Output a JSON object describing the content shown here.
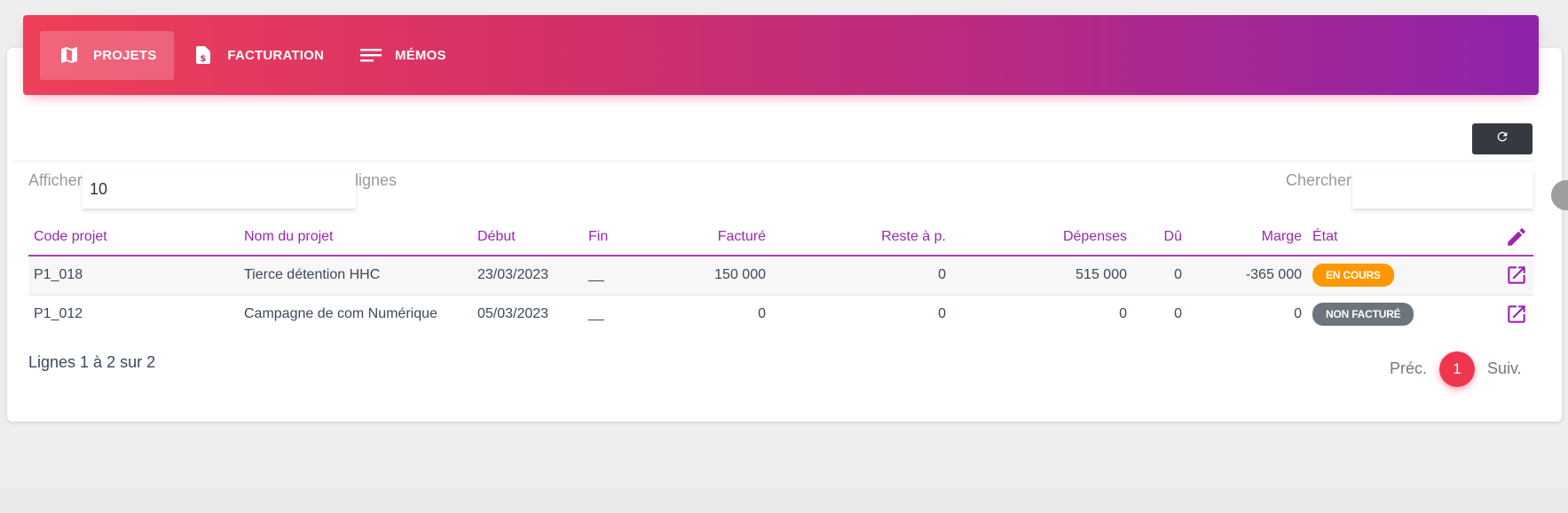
{
  "nav": {
    "tabs": [
      {
        "label": "PROJETS",
        "icon": "map-icon",
        "active": true
      },
      {
        "label": "FACTURATION",
        "icon": "invoice-icon",
        "active": false
      },
      {
        "label": "MÉMOS",
        "icon": "notes-icon",
        "active": false
      }
    ]
  },
  "toolbar": {
    "refresh_icon": "refresh-icon"
  },
  "length": {
    "prefix": "Afficher",
    "value": "10",
    "suffix": "lignes"
  },
  "search": {
    "label": "Chercher:",
    "value": ""
  },
  "table": {
    "headers": [
      "Code projet",
      "Nom du projet",
      "Début",
      "Fin",
      "Facturé",
      "Reste à p.",
      "Dépenses",
      "Dû",
      "Marge",
      "État"
    ],
    "rows": [
      {
        "code": "P1_018",
        "name": "Tierce détention HHC",
        "start": "23/03/2023",
        "end": "__",
        "billed": "150 000",
        "remaining": "0",
        "expenses": "515 000",
        "due": "0",
        "margin": "-365 000",
        "status": "EN COURS",
        "status_color": "#ff9800"
      },
      {
        "code": "P1_012",
        "name": "Campagne de com Numérique",
        "start": "05/03/2023",
        "end": "__",
        "billed": "0",
        "remaining": "0",
        "expenses": "0",
        "due": "0",
        "margin": "0",
        "status": "NON FACTURÉ",
        "status_color": "#6c757d"
      }
    ]
  },
  "pagination": {
    "info": "Lignes 1 à 2 sur 2",
    "prev": "Préc.",
    "current": "1",
    "next": "Suiv."
  },
  "colors": {
    "accent": "#9c27b0",
    "gradient_start": "#ef4059",
    "gradient_end": "#8e24aa",
    "page_active": "#f0364f"
  }
}
